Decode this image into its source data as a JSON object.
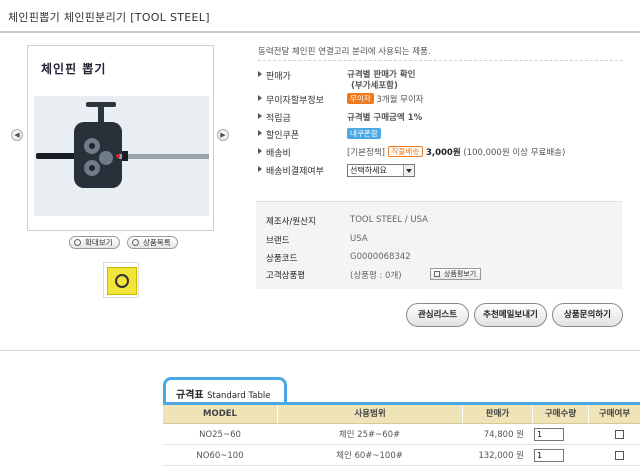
{
  "page": {
    "title": "체인핀뽑기 체인핀분리기 [TOOL STEEL]"
  },
  "gallery": {
    "caption": "체인핀 뽑기",
    "prev_icon": "chevron-left-icon",
    "next_icon": "chevron-right-icon",
    "prev_symbol": "◀",
    "next_symbol": "▶",
    "zoom_label": "확대보기",
    "list_label": "상품목록"
  },
  "product": {
    "description": "동력전달 체인핀 연결고리 분리에 사용되는 제품.",
    "price_label": "판매가",
    "price_value_line1": "규격별 판매가 확인",
    "price_value_line2": "(부가세포함)",
    "interest_label": "무이자할부정보",
    "interest_badge": "무이자",
    "interest_value": "3개월 무이자",
    "points_label": "적립금",
    "points_value": "규격별 구매금액 1%",
    "coupon_label": "할인쿠폰",
    "coupon_badge": "내쿠폰함",
    "shipping_label": "배송비",
    "shipping_policy": "[기본정책]",
    "shipping_badge": "착불배송",
    "shipping_price": "3,000원",
    "shipping_note": "(100,000원 이상 무료배송)",
    "payment_label": "배송비결제여부",
    "payment_selected": "선택하세요"
  },
  "info": {
    "maker_label": "제조사/원산지",
    "maker_value": "TOOL STEEL / USA",
    "brand_label": "브랜드",
    "brand_value": "USA",
    "code_label": "상품코드",
    "code_value": "G0000068342",
    "review_label": "고객상품평",
    "review_value": "(상품평 : 0개)",
    "review_button": "상품평보기"
  },
  "actions": {
    "wishlist": "관심리스트",
    "recommend": "추천메일보내기",
    "inquiry": "상품문의하기"
  },
  "spec": {
    "tab_title": "규격표",
    "tab_sub": "Standard Table",
    "headers": [
      "MODEL",
      "사용범위",
      "판매가",
      "구매수량",
      "구매여부"
    ],
    "rows": [
      {
        "model": "NO25~60",
        "range": "체인 25#~60#",
        "price": "74,800 원",
        "qty": "1"
      },
      {
        "model": "NO60~100",
        "range": "체인 60#~100#",
        "price": "132,000 원",
        "qty": "1"
      }
    ]
  },
  "colors": {
    "accent_blue": "#4aa8e6",
    "price_red": "#e8204b",
    "points_blue": "#1f7bbf",
    "badge_orange": "#f07a1e",
    "table_header": "#efe3b8"
  }
}
